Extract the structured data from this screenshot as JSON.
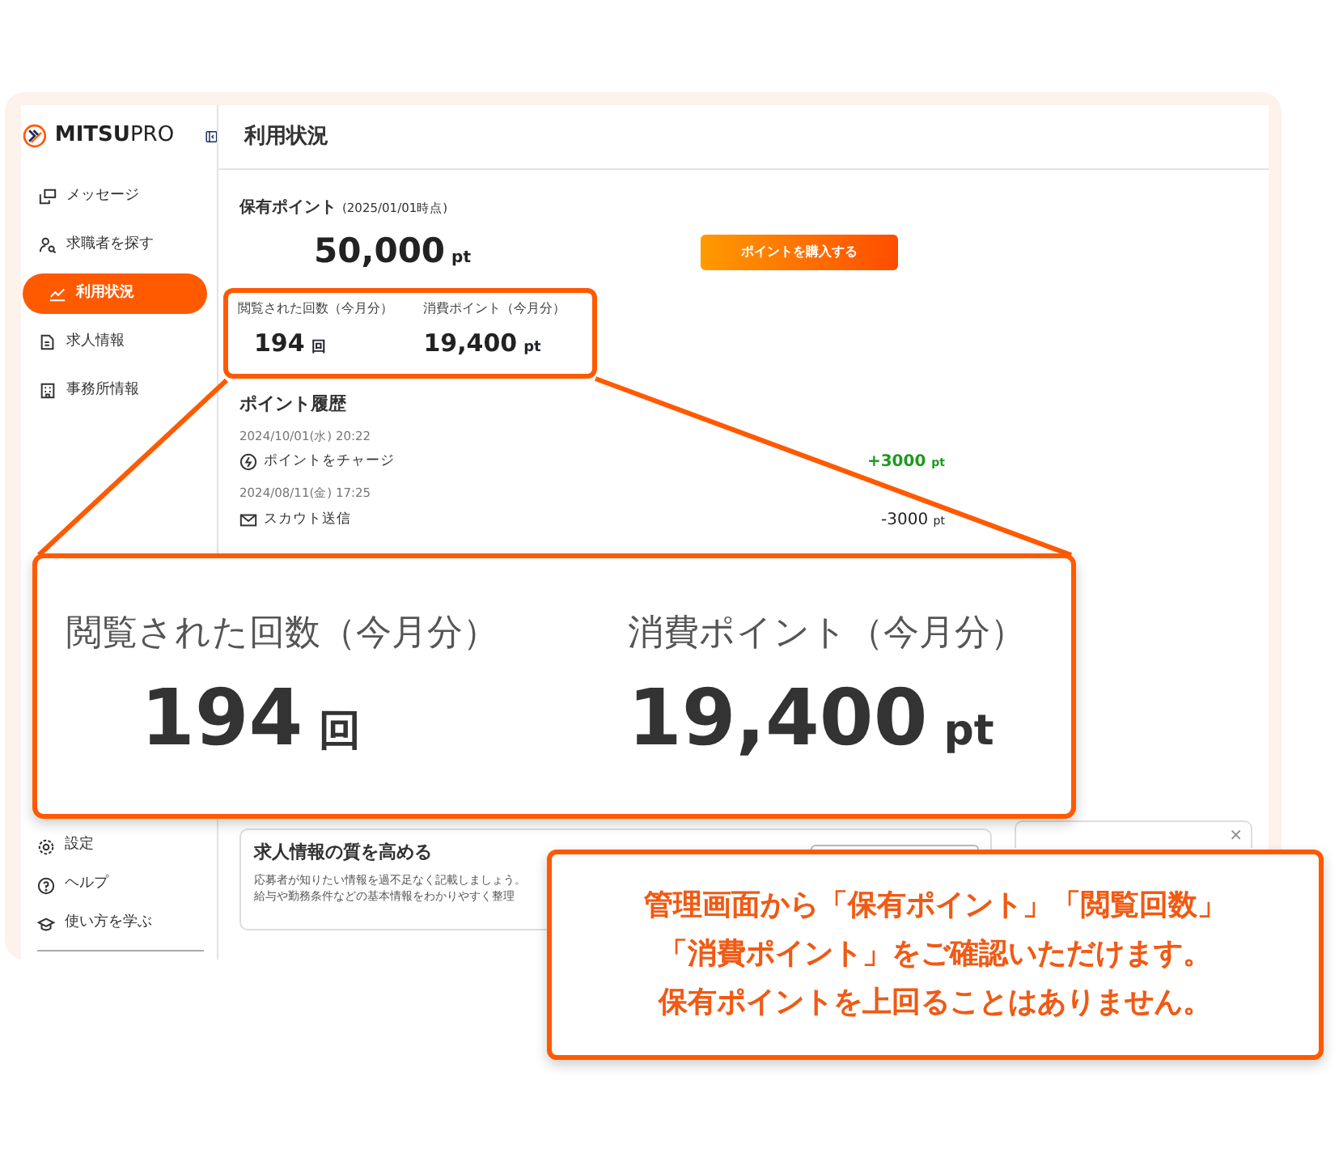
{
  "sidebar": {
    "logo": "**MITSU**PRO",
    "items": [
      {
        "label": "メッセージ",
        "selected": false
      },
      {
        "label": "求職者を探す",
        "selected": false
      },
      {
        "label": "利用状況",
        "selected": true
      },
      {
        "label": "求人情報",
        "selected": false
      },
      {
        "label": "事務所情報",
        "selected": false
      }
    ],
    "footer_items": [
      {
        "label": "設定"
      },
      {
        "label": "ヘルプ"
      },
      {
        "label": "使い方を学ぶ"
      }
    ]
  },
  "main": {
    "title": "利用状況",
    "points": {
      "label": "保有ポイント",
      "as_of": "(2025/01/01時点)",
      "value": "50,000",
      "unit": "pt"
    },
    "buy_button": "ポイントを購入する",
    "stats": [
      {
        "label": "閲覧された回数（今月分）",
        "value": "194",
        "unit": "回"
      },
      {
        "label": "消費ポイント（今月分）",
        "value": "19,400",
        "unit": "pt"
      }
    ],
    "history": {
      "title": "ポイント履歴",
      "entries": [
        {
          "date": "2024/10/01(水) 20:22",
          "label": "ポイントをチャージ",
          "amount": "+3000",
          "unit": "pt",
          "kind": "credit"
        },
        {
          "date": "2024/08/11(金) 17:25",
          "label": "スカウト送信",
          "amount": "-3000",
          "unit": "pt",
          "kind": "debit"
        }
      ]
    },
    "tips_card": {
      "title": "求人情報の質を高める",
      "lines": [
        "応募者が知りたい情報を過不足なく記載しましょう。",
        "給与や勤務条件などの基本情報をわかりやすく整理"
      ]
    },
    "side_card": {
      "close": "×"
    }
  },
  "zoom_lens": {
    "stats": [
      {
        "label": "閲覧された回数（今月分）",
        "value": "194",
        "unit": "回"
      },
      {
        "label": "消費ポイント（今月分）",
        "value": "19,400",
        "unit": "pt"
      }
    ]
  },
  "callout": {
    "lines": [
      "管理画面から「保有ポイント」「閲覧回数」",
      "「消費ポイント」をご確認いただけます。",
      "保有ポイントを上回ることはありません。"
    ]
  }
}
